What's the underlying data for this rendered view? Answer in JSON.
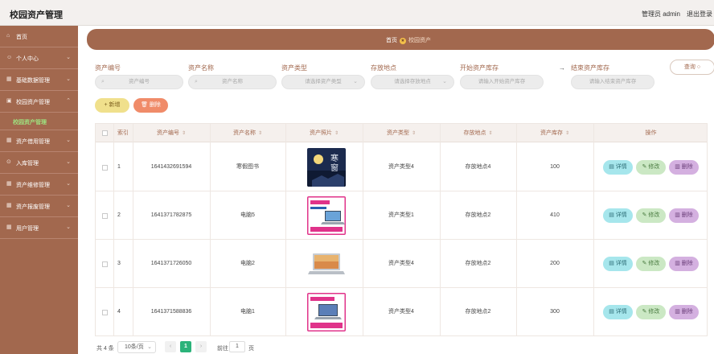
{
  "app": {
    "title": "校园资产管理",
    "admin": "管理员 admin",
    "logout": "退出登录"
  },
  "sidebar": {
    "items": [
      {
        "label": "首页",
        "icon": "home-icon"
      },
      {
        "label": "个人中心",
        "icon": "user-icon"
      },
      {
        "label": "基础数据管理",
        "icon": "grid-icon"
      },
      {
        "label": "校园资产管理",
        "icon": "box-icon"
      },
      {
        "label": "资产借用管理",
        "icon": "grid-icon"
      },
      {
        "label": "入库管理",
        "icon": "download-icon"
      },
      {
        "label": "资产维修管理",
        "icon": "grid-icon"
      },
      {
        "label": "资产报废管理",
        "icon": "grid-icon"
      },
      {
        "label": "用户管理",
        "icon": "grid-icon"
      }
    ],
    "active_sub": "校园资产管理"
  },
  "breadcrumb": {
    "home": "首页",
    "current": "校园资产"
  },
  "filters": {
    "code": {
      "label": "资产编号",
      "placeholder": "资产编号"
    },
    "name": {
      "label": "资产名称",
      "placeholder": "资产名称"
    },
    "type": {
      "label": "资产类型",
      "placeholder": "请选择资产类型"
    },
    "location": {
      "label": "存放地点",
      "placeholder": "请选择存放地点"
    },
    "stock_start": {
      "label": "开始资产库存",
      "placeholder": "请输入开始资产库存"
    },
    "stock_end": {
      "label": "结束资产库存",
      "placeholder": "请输入结束资产库存"
    },
    "query": "查询"
  },
  "actions": {
    "add": "新增",
    "delete": "删除"
  },
  "table": {
    "headers": [
      "索引",
      "资产编号",
      "资产名称",
      "资产照片",
      "资产类型",
      "存放地点",
      "资产库存",
      "操作"
    ],
    "rows": [
      {
        "index": "1",
        "code": "1641432691594",
        "name": "寒假图书",
        "type": "资产类型4",
        "location": "存放地点4",
        "stock": "100",
        "photo": "book-cover"
      },
      {
        "index": "2",
        "code": "1641371782875",
        "name": "电脑5",
        "type": "资产类型1",
        "location": "存放地点2",
        "stock": "410",
        "photo": "laptop-ad"
      },
      {
        "index": "3",
        "code": "1641371726050",
        "name": "电脑2",
        "type": "资产类型4",
        "location": "存放地点2",
        "stock": "200",
        "photo": "laptop-silver"
      },
      {
        "index": "4",
        "code": "1641371588836",
        "name": "电脑1",
        "type": "资产类型4",
        "location": "存放地点2",
        "stock": "300",
        "photo": "laptop-ad"
      }
    ],
    "row_actions": {
      "detail": "详情",
      "edit": "修改",
      "remove": "删除"
    }
  },
  "pagination": {
    "total": "共 4 条",
    "page_size": "10条/页",
    "current": "1",
    "goto_label": "前往",
    "goto_value": "1",
    "page_suffix": "页"
  },
  "colors": {
    "brand": "#a2684e",
    "active": "#9ee07f",
    "page_current": "#2bb37a"
  }
}
